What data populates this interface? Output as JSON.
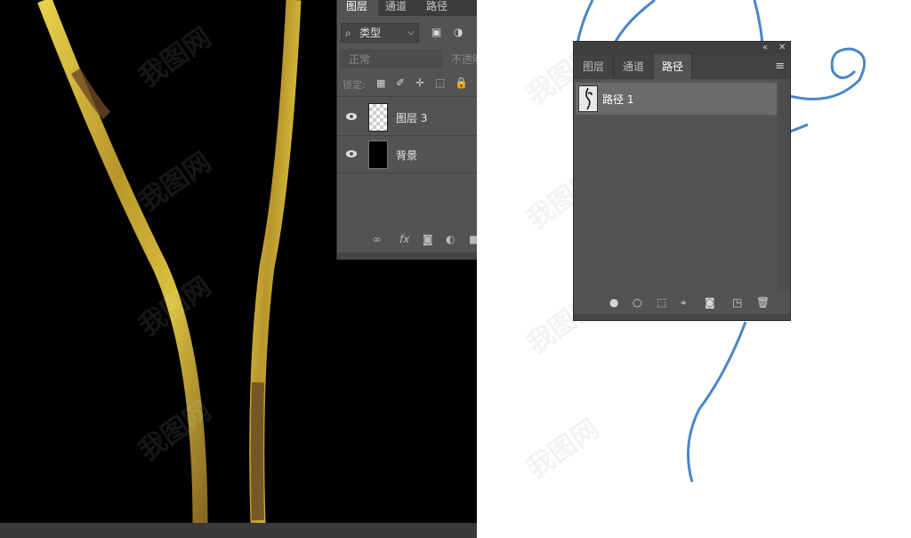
{
  "layers_panel": {
    "tabs": [
      "图层",
      "通道",
      "路径"
    ],
    "active_tab": "图层",
    "filter_label": "类型",
    "blend_mode": "正常",
    "opacity_label": "不透明度",
    "lock_label": "锁定:",
    "layers": [
      {
        "name": "图层 3",
        "thumb": "transparent"
      },
      {
        "name": "背景",
        "thumb": "black"
      }
    ],
    "footer_icons": [
      "link-icon",
      "fx-icon",
      "mask-icon",
      "adjustment-icon",
      "folder-icon"
    ],
    "fx_label": "fx"
  },
  "paths_panel": {
    "tabs": [
      "图层",
      "通道",
      "路径"
    ],
    "active_tab": "路径",
    "paths": [
      {
        "name": "路径 1"
      }
    ],
    "footer_icons": [
      "fill-path-icon",
      "stroke-path-icon",
      "load-selection-icon",
      "make-work-path-icon",
      "add-mask-icon",
      "new-path-icon",
      "trash-icon"
    ]
  },
  "watermark_text": "我图网",
  "colors": {
    "path_stroke": "#4a86c8",
    "gold": "#c9a93a",
    "panel_bg": "#535353"
  }
}
